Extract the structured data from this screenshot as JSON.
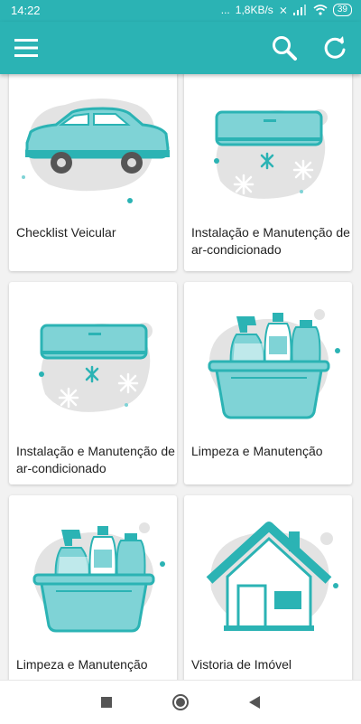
{
  "status_bar": {
    "time": "14:22",
    "notifications": "...",
    "network_speed": "1,8KB/s",
    "battery_level": "39"
  },
  "app_bar": {
    "menu_icon": "hamburger-menu-icon",
    "search_icon": "search-icon",
    "refresh_icon": "refresh-icon"
  },
  "cards": [
    {
      "title": "Checklist Veicular",
      "illustration": "car"
    },
    {
      "title": "Instalação e Manutenção de ar-condicionado",
      "illustration": "air-conditioner"
    },
    {
      "title": "Instalação e Manutenção de ar-condicionado",
      "illustration": "air-conditioner"
    },
    {
      "title": "Limpeza e Manutenção",
      "illustration": "cleaning-basket"
    },
    {
      "title": "Limpeza e Manutenção",
      "illustration": "cleaning-basket"
    },
    {
      "title": "Vistoria de Imóvel",
      "illustration": "house"
    }
  ],
  "nav_bar": {
    "recents_icon": "square-recents-icon",
    "home_icon": "circle-home-icon",
    "back_icon": "triangle-back-icon"
  },
  "colors": {
    "primary": "#2bb3b4",
    "accent_light": "#7fd3d6",
    "blob_gray": "#e3e3e3",
    "background": "#f2f2f2"
  }
}
